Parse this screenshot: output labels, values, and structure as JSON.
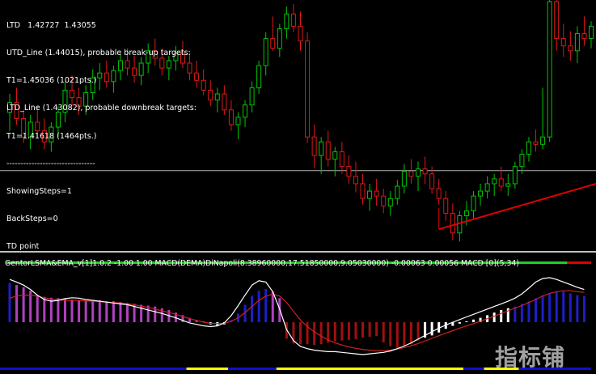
{
  "info_panel": {
    "lines": [
      "LTD   1.42727  1.43055",
      "UTD_Line (1.44015), probable break-up targets:",
      "T1=1.45036 (1021pts.)",
      "LTD_Line (1.43082), probable downbreak targets:",
      "T1=1.41618 (1464pts.)",
      "--------------------------------",
      "ShowingSteps=1",
      "BackSteps=0",
      "TD point"
    ]
  },
  "indicator_title": "GentorLSMA&EMA_v[1]1.0.2  -1.00 1.00  MACD(DEMA)DiNapoli(8.38960000,17.51850000,9.05030000) -0.00063 0.00056  MACD [0](5,34)",
  "watermark": "指标铺",
  "colors": {
    "background": "#000000",
    "bull_candle": "#00c800",
    "bear_candle": "#e01818",
    "td_line": "#e00000",
    "horizontal_line": "#b4b4b4",
    "separator": "#c0c0c0",
    "hist_blue": "#1e1ec8",
    "hist_purple": "#b040c0",
    "hist_darkred": "#a01010",
    "hist_white": "#ffffff",
    "macd_line": "#ffffff",
    "signal_line": "#cc2020",
    "bar_blue": "#1010d0",
    "bar_yellow": "#ffff00",
    "bar_green": "#20d020",
    "bar_red": "#e00000"
  },
  "chart_data": [
    {
      "type": "candlestick",
      "ohlc": [
        [
          1.432,
          1.4335,
          1.4305,
          1.4328
        ],
        [
          1.4328,
          1.434,
          1.431,
          1.4315
        ],
        [
          1.4315,
          1.4322,
          1.4295,
          1.43
        ],
        [
          1.43,
          1.4318,
          1.429,
          1.4312
        ],
        [
          1.4312,
          1.4325,
          1.43,
          1.4305
        ],
        [
          1.4305,
          1.4315,
          1.429,
          1.4296
        ],
        [
          1.4296,
          1.4312,
          1.4288,
          1.4308
        ],
        [
          1.4308,
          1.4325,
          1.43,
          1.432
        ],
        [
          1.432,
          1.4345,
          1.4312,
          1.4338
        ],
        [
          1.4338,
          1.435,
          1.4325,
          1.4332
        ],
        [
          1.4332,
          1.434,
          1.4318,
          1.4325
        ],
        [
          1.4325,
          1.4342,
          1.4318,
          1.4336
        ],
        [
          1.4336,
          1.4355,
          1.433,
          1.4348
        ],
        [
          1.4348,
          1.436,
          1.4338,
          1.4352
        ],
        [
          1.4352,
          1.4362,
          1.434,
          1.4345
        ],
        [
          1.4345,
          1.4358,
          1.4336,
          1.4354
        ],
        [
          1.4354,
          1.4368,
          1.4346,
          1.4362
        ],
        [
          1.4362,
          1.4372,
          1.435,
          1.4356
        ],
        [
          1.4356,
          1.4366,
          1.4344,
          1.435
        ],
        [
          1.435,
          1.4365,
          1.4342,
          1.436
        ],
        [
          1.436,
          1.4376,
          1.4352,
          1.437
        ],
        [
          1.437,
          1.438,
          1.4358,
          1.4364
        ],
        [
          1.4364,
          1.4372,
          1.435,
          1.4356
        ],
        [
          1.4356,
          1.4366,
          1.4346,
          1.4362
        ],
        [
          1.4362,
          1.4374,
          1.4354,
          1.4368
        ],
        [
          1.4368,
          1.4378,
          1.4356,
          1.436
        ],
        [
          1.436,
          1.4368,
          1.4346,
          1.4352
        ],
        [
          1.4352,
          1.4362,
          1.434,
          1.4346
        ],
        [
          1.4346,
          1.4355,
          1.4334,
          1.4338
        ],
        [
          1.4338,
          1.4346,
          1.4325,
          1.433
        ],
        [
          1.433,
          1.434,
          1.432,
          1.4335
        ],
        [
          1.4335,
          1.4342,
          1.4318,
          1.4322
        ],
        [
          1.4322,
          1.433,
          1.4305,
          1.431
        ],
        [
          1.431,
          1.432,
          1.4298,
          1.4316
        ],
        [
          1.4316,
          1.433,
          1.4308,
          1.4326
        ],
        [
          1.4326,
          1.4345,
          1.432,
          1.434
        ],
        [
          1.434,
          1.4362,
          1.4335,
          1.4358
        ],
        [
          1.4358,
          1.4385,
          1.435,
          1.438
        ],
        [
          1.438,
          1.4398,
          1.437,
          1.4372
        ],
        [
          1.4372,
          1.4392,
          1.4365,
          1.4388
        ],
        [
          1.4388,
          1.4406,
          1.438,
          1.44
        ],
        [
          1.44,
          1.4408,
          1.4385,
          1.439
        ],
        [
          1.439,
          1.4402,
          1.437,
          1.4378
        ],
        [
          1.4378,
          1.4385,
          1.4295,
          1.43
        ],
        [
          1.43,
          1.431,
          1.4275,
          1.4285
        ],
        [
          1.4285,
          1.43,
          1.427,
          1.4296
        ],
        [
          1.4296,
          1.4305,
          1.4276,
          1.4282
        ],
        [
          1.4282,
          1.4292,
          1.4268,
          1.4288
        ],
        [
          1.4288,
          1.4296,
          1.427,
          1.4276
        ],
        [
          1.4276,
          1.4285,
          1.4262,
          1.4268
        ],
        [
          1.4268,
          1.428,
          1.4255,
          1.4262
        ],
        [
          1.4262,
          1.427,
          1.4245,
          1.425
        ],
        [
          1.425,
          1.4262,
          1.424,
          1.4256
        ],
        [
          1.4256,
          1.4266,
          1.4244,
          1.4252
        ],
        [
          1.4252,
          1.4258,
          1.4238,
          1.4244
        ],
        [
          1.4244,
          1.4256,
          1.4236,
          1.425
        ],
        [
          1.425,
          1.4265,
          1.4245,
          1.426
        ],
        [
          1.426,
          1.4278,
          1.4254,
          1.4272
        ],
        [
          1.4272,
          1.4282,
          1.4262,
          1.4268
        ],
        [
          1.4268,
          1.428,
          1.4256,
          1.4274
        ],
        [
          1.4274,
          1.4284,
          1.4262,
          1.427
        ],
        [
          1.427,
          1.4276,
          1.4254,
          1.4258
        ],
        [
          1.4258,
          1.4266,
          1.4245,
          1.425
        ],
        [
          1.425,
          1.4256,
          1.4232,
          1.4238
        ],
        [
          1.4238,
          1.4246,
          1.4216,
          1.4222
        ],
        [
          1.4222,
          1.424,
          1.4215,
          1.4236
        ],
        [
          1.4236,
          1.4248,
          1.4228,
          1.424
        ],
        [
          1.424,
          1.4256,
          1.4234,
          1.4252
        ],
        [
          1.4252,
          1.4262,
          1.4244,
          1.4256
        ],
        [
          1.4256,
          1.4268,
          1.425,
          1.4262
        ],
        [
          1.4262,
          1.427,
          1.4252,
          1.4266
        ],
        [
          1.4266,
          1.4276,
          1.4256,
          1.426
        ],
        [
          1.426,
          1.427,
          1.4252,
          1.4262
        ],
        [
          1.4262,
          1.428,
          1.4258,
          1.4276
        ],
        [
          1.4276,
          1.429,
          1.427,
          1.4286
        ],
        [
          1.4286,
          1.43,
          1.428,
          1.4296
        ],
        [
          1.4296,
          1.4306,
          1.4288,
          1.4294
        ],
        [
          1.4294,
          1.434,
          1.429,
          1.43
        ],
        [
          1.43,
          1.442,
          1.4296,
          1.441
        ],
        [
          1.441,
          1.4425,
          1.437,
          1.438
        ],
        [
          1.438,
          1.4392,
          1.4365,
          1.4374
        ],
        [
          1.4374,
          1.4386,
          1.4362,
          1.437
        ],
        [
          1.437,
          1.439,
          1.436,
          1.4384
        ],
        [
          1.4384,
          1.4398,
          1.4374,
          1.438
        ],
        [
          1.438,
          1.4394,
          1.4372,
          1.439
        ]
      ],
      "td_line": {
        "from_bar": 62,
        "from_price": 1.4225,
        "to_bar": 84,
        "to_price": 1.4262
      },
      "horizontal_level": 1.42727,
      "ylim": [
        1.421,
        1.441
      ]
    },
    {
      "type": "bar",
      "title": "GentorLSMA&EMA_v[1]1.0.2 MACD(DEMA)DiNapoli",
      "histogram": [
        0.9,
        0.85,
        0.8,
        0.72,
        0.62,
        0.58,
        0.56,
        0.55,
        0.54,
        0.52,
        0.5,
        0.5,
        0.5,
        0.5,
        0.48,
        0.48,
        0.46,
        0.44,
        0.42,
        0.4,
        0.38,
        0.36,
        0.32,
        0.28,
        0.22,
        0.16,
        0.1,
        0.05,
        0.02,
        -0.06,
        -0.1,
        -0.06,
        0.05,
        0.2,
        0.4,
        0.6,
        0.72,
        0.76,
        0.7,
        0.55,
        -0.45,
        -0.58,
        -0.6,
        -0.6,
        -0.62,
        -0.6,
        -0.56,
        -0.52,
        -0.5,
        -0.48,
        -0.46,
        -0.42,
        -0.4,
        -0.38,
        -0.55,
        -0.65,
        -0.7,
        -0.66,
        -0.6,
        -0.5,
        -0.42,
        -0.36,
        -0.28,
        -0.18,
        -0.1,
        -0.04,
        0.02,
        0.06,
        0.1,
        0.16,
        0.22,
        0.28,
        0.32,
        0.36,
        0.42,
        0.48,
        0.55,
        0.62,
        0.66,
        0.7,
        0.7,
        0.66,
        0.62,
        0.6
      ],
      "hist_colors": [
        "blue",
        "purple",
        "purple",
        "purple",
        "purple",
        "purple",
        "purple",
        "purple",
        "purple",
        "purple",
        "purple",
        "purple",
        "purple",
        "purple",
        "purple",
        "purple",
        "purple",
        "purple",
        "purple",
        "purple",
        "purple",
        "purple",
        "purple",
        "purple",
        "purple",
        "purple",
        "purple",
        "purple",
        "purple",
        "white",
        "white",
        "white",
        "blue",
        "blue",
        "blue",
        "blue",
        "blue",
        "blue",
        "purple",
        "purple",
        "darkred",
        "darkred",
        "darkred",
        "darkred",
        "darkred",
        "darkred",
        "darkred",
        "darkred",
        "darkred",
        "darkred",
        "darkred",
        "darkred",
        "darkred",
        "darkred",
        "darkred",
        "darkred",
        "darkred",
        "darkred",
        "darkred",
        "darkred",
        "white",
        "white",
        "white",
        "white",
        "white",
        "white",
        "white",
        "white",
        "white",
        "white",
        "white",
        "white",
        "white",
        "blue",
        "blue",
        "blue",
        "blue",
        "blue",
        "blue",
        "blue",
        "blue",
        "blue",
        "blue",
        "blue"
      ],
      "macd_line": [
        0.98,
        0.92,
        0.85,
        0.75,
        0.62,
        0.52,
        0.48,
        0.5,
        0.54,
        0.56,
        0.55,
        0.52,
        0.5,
        0.48,
        0.46,
        0.44,
        0.42,
        0.4,
        0.36,
        0.32,
        0.28,
        0.24,
        0.2,
        0.15,
        0.1,
        0.04,
        -0.02,
        -0.06,
        -0.1,
        -0.12,
        -0.1,
        -0.02,
        0.15,
        0.38,
        0.62,
        0.85,
        0.95,
        0.92,
        0.7,
        0.3,
        -0.2,
        -0.5,
        -0.66,
        -0.72,
        -0.76,
        -0.78,
        -0.8,
        -0.8,
        -0.82,
        -0.84,
        -0.86,
        -0.88,
        -0.86,
        -0.84,
        -0.82,
        -0.78,
        -0.72,
        -0.65,
        -0.56,
        -0.46,
        -0.36,
        -0.26,
        -0.16,
        -0.08,
        0.0,
        0.06,
        0.12,
        0.18,
        0.24,
        0.3,
        0.36,
        0.42,
        0.48,
        0.55,
        0.65,
        0.78,
        0.92,
        1.0,
        1.02,
        0.98,
        0.92,
        0.86,
        0.8,
        0.75
      ],
      "signal_line": [
        0.55,
        0.6,
        0.62,
        0.62,
        0.6,
        0.56,
        0.53,
        0.51,
        0.5,
        0.5,
        0.5,
        0.49,
        0.48,
        0.47,
        0.46,
        0.45,
        0.44,
        0.42,
        0.4,
        0.37,
        0.34,
        0.3,
        0.26,
        0.22,
        0.18,
        0.13,
        0.08,
        0.04,
        0.0,
        -0.03,
        -0.04,
        -0.03,
        0.02,
        0.1,
        0.22,
        0.36,
        0.5,
        0.6,
        0.64,
        0.6,
        0.45,
        0.25,
        0.05,
        -0.12,
        -0.26,
        -0.38,
        -0.48,
        -0.56,
        -0.62,
        -0.67,
        -0.71,
        -0.74,
        -0.76,
        -0.77,
        -0.77,
        -0.76,
        -0.73,
        -0.69,
        -0.64,
        -0.58,
        -0.51,
        -0.44,
        -0.37,
        -0.3,
        -0.23,
        -0.16,
        -0.1,
        -0.04,
        0.02,
        0.08,
        0.14,
        0.2,
        0.26,
        0.32,
        0.38,
        0.45,
        0.52,
        0.6,
        0.66,
        0.7,
        0.72,
        0.72,
        0.7,
        0.68
      ],
      "ylim": [
        -1.1,
        1.15
      ],
      "state_bar_bottom": [
        {
          "color": "blue",
          "from": 0,
          "to": 26
        },
        {
          "color": "yellow",
          "from": 26,
          "to": 32
        },
        {
          "color": "blue",
          "from": 32,
          "to": 39
        },
        {
          "color": "yellow",
          "from": 39,
          "to": 66
        },
        {
          "color": "blue",
          "from": 66,
          "to": 69
        },
        {
          "color": "yellow",
          "from": 69,
          "to": 74
        },
        {
          "color": "blue",
          "from": 74,
          "to": 84
        }
      ],
      "state_bar_top": [
        {
          "color": "green",
          "from": 0,
          "to": 81
        },
        {
          "color": "red",
          "from": 81,
          "to": 84
        }
      ]
    }
  ]
}
